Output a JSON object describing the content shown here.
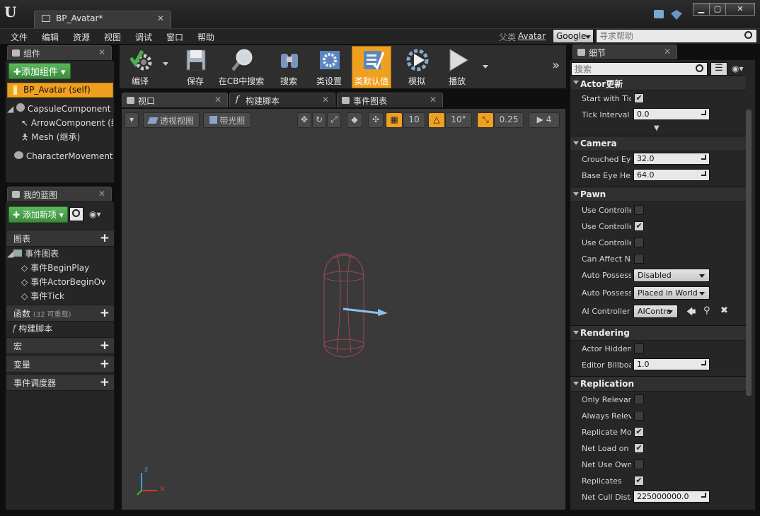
{
  "window": {
    "tab_title": "BP_Avatar*",
    "logo": "U",
    "parent_label": "父类",
    "parent_value": "Avatar",
    "search_engine": "Google",
    "search_placeholder": "寻求帮助"
  },
  "menu": [
    "文件",
    "编辑",
    "资源",
    "视图",
    "调试",
    "窗口",
    "帮助"
  ],
  "components": {
    "tab": "组件",
    "add_button": "添加组件",
    "self": "BP_Avatar (self)",
    "items": [
      "CapsuleComponent (继",
      "ArrowComponent (继",
      "Mesh (继承)",
      "CharacterMovement (继"
    ]
  },
  "blueprint": {
    "tab": "我的蓝图",
    "add_button": "添加新项",
    "graphs_header": "图表",
    "event_graph": "事件图表",
    "events": [
      "事件BeginPlay",
      "事件ActorBeginOv",
      "事件Tick"
    ],
    "functions_header": "函数",
    "functions_count": "(32 可重载)",
    "construction": "构建脚本",
    "macros": "宏",
    "variables": "变量",
    "dispatchers": "事件调度器"
  },
  "toolbar": [
    {
      "label": "编译",
      "icon": "gear-icon"
    },
    {
      "label": "保存",
      "icon": "save-icon"
    },
    {
      "label": "在CB中搜索",
      "icon": "magnifier-icon"
    },
    {
      "label": "搜索",
      "icon": "binoculars-icon"
    },
    {
      "label": "类设置",
      "icon": "class-settings-icon"
    },
    {
      "label": "类默认值",
      "icon": "class-defaults-icon"
    },
    {
      "label": "模拟",
      "icon": "simulate-icon"
    },
    {
      "label": "播放",
      "icon": "play-icon"
    }
  ],
  "editor_tabs": [
    "视口",
    "构建脚本",
    "事件图表"
  ],
  "viewport": {
    "perspective": "透视视图",
    "lit": "带光照",
    "grid_snap": "10",
    "rot_snap": "10°",
    "scale_snap": "0.25",
    "cam_speed": "4",
    "axis_z": "z",
    "axis_x": "X"
  },
  "details": {
    "tab": "细节",
    "search_placeholder": "搜索",
    "actor_tick_header": "Actor更新",
    "start_with_tick": "Start with Tick",
    "tick_interval": "Tick Interval",
    "tick_interval_value": "0.0",
    "camera": "Camera",
    "crouched_eye": "Crouched Eye",
    "crouched_eye_value": "32.0",
    "base_eye": "Base Eye Height",
    "base_eye_value": "64.0",
    "pawn": "Pawn",
    "use_ctrl1": "Use Controller",
    "use_ctrl2": "Use Controller",
    "use_ctrl3": "Use Controller",
    "can_affect": "Can Affect Na",
    "auto_possess1": "Auto Possess",
    "auto_possess1_value": "Disabled",
    "auto_possess2": "Auto Possess",
    "auto_possess2_value": "Placed in World",
    "ai_ctrl": "AI Controller C",
    "ai_ctrl_value": "AIContro",
    "rendering": "Rendering",
    "actor_hidden": "Actor Hidden",
    "editor_billboard": "Editor Billboa",
    "editor_billboard_value": "1.0",
    "replication": "Replication",
    "only_relevant": "Only Relevan",
    "always_relevant": "Always Relev",
    "replicate_mov": "Replicate Mov",
    "net_load": "Net Load on C",
    "net_use_owner": "Net Use Owne",
    "replicates": "Replicates",
    "net_cull": "Net Cull Dista",
    "net_cull_value": "225000000.0"
  },
  "colors": {
    "accent": "#f0a020",
    "green": "#4caa4c",
    "panel": "#262626"
  }
}
